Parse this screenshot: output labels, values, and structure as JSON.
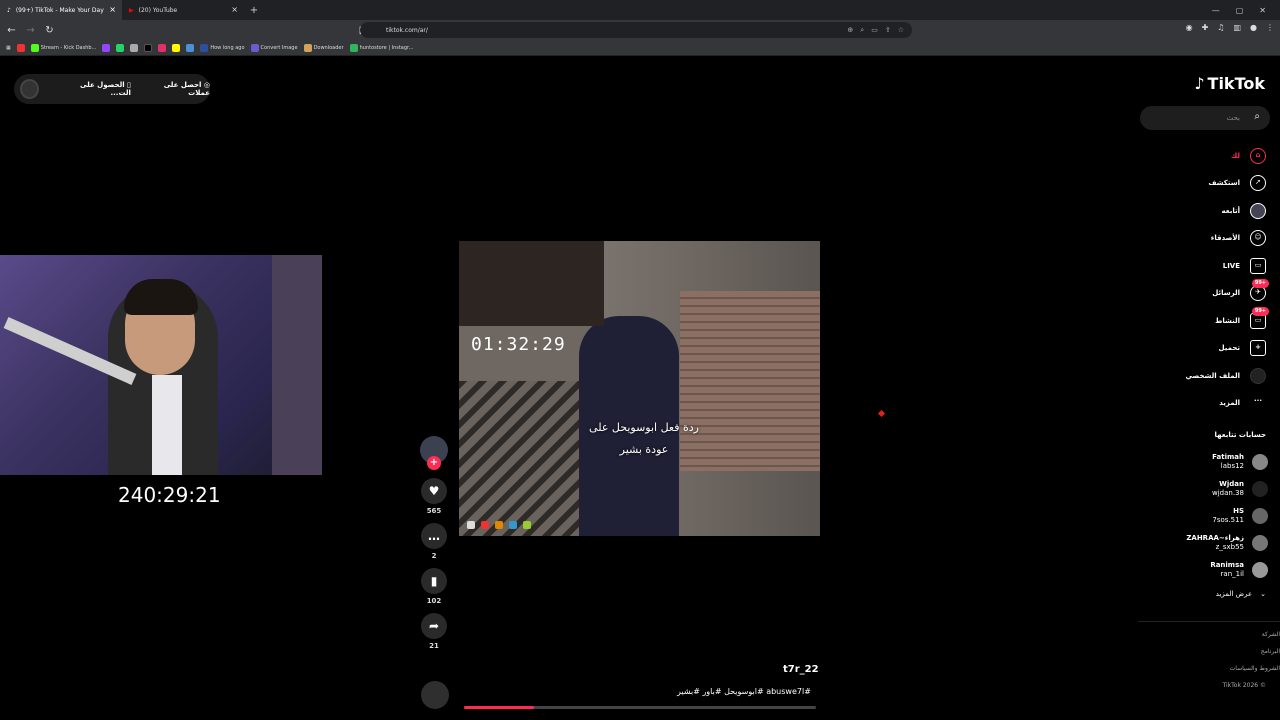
{
  "browser": {
    "tabs": [
      {
        "title": "(99+) TikTok - Make Your Day",
        "active": true
      },
      {
        "title": "(20) YouTube",
        "active": false
      }
    ],
    "url": "tiktok.com/ar/",
    "bookmarks": [
      "Stream - Kick Dashb...",
      "How long ago",
      "Convert Image",
      "Downloader",
      "huntostore | Instagr..."
    ]
  },
  "top_left": {
    "label1": "احصل على عملات",
    "label2": "الحصول على الت..."
  },
  "stream": {
    "timer": "240:29:21"
  },
  "video": {
    "clock": "01:32:29",
    "caption_line1": "ردة فعل ابوسويحل على",
    "caption_line2": "عودة بشير",
    "username": "t7r_22",
    "hashtags": "#abuswe7l #ابوسويحل #باور #بشير",
    "progress_fraction": 0.2
  },
  "actions": {
    "likes": "565",
    "comments": "2",
    "saves": "102",
    "shares": "21"
  },
  "sidebar": {
    "logo": "TikTok",
    "search_placeholder": "بحث",
    "nav": [
      {
        "label": "لك",
        "icon": "home-icon"
      },
      {
        "label": "استكشف",
        "icon": "compass-icon"
      },
      {
        "label": "أتابعه",
        "icon": "following-icon"
      },
      {
        "label": "الأصدقاء",
        "icon": "friends-icon"
      },
      {
        "label": "LIVE",
        "icon": "live-icon"
      },
      {
        "label": "الرسائل",
        "icon": "messages-icon",
        "badge": "99+"
      },
      {
        "label": "النشاط",
        "icon": "activity-icon",
        "badge": "99+"
      },
      {
        "label": "تحميل",
        "icon": "upload-icon"
      },
      {
        "label": "الملف الشخصي",
        "icon": "profile-icon"
      },
      {
        "label": "المزيد",
        "icon": "more-icon"
      }
    ],
    "following_title": "حسابات تتابعها",
    "following": [
      {
        "name": "Fatimah",
        "handle": "labs12"
      },
      {
        "name": "Wjdan",
        "handle": "wjdan.38"
      },
      {
        "name": "HS",
        "handle": "7sos.511"
      },
      {
        "name": "ZAHRAA~زهراء",
        "handle": "z_sxb55"
      },
      {
        "name": "Ranimsa",
        "handle": "ran_1il"
      }
    ],
    "see_more": "عرض المزيد",
    "footer": [
      "الشركة",
      "البرنامج",
      "الشروط والسياسات",
      "TikTok 2026 ©"
    ]
  }
}
